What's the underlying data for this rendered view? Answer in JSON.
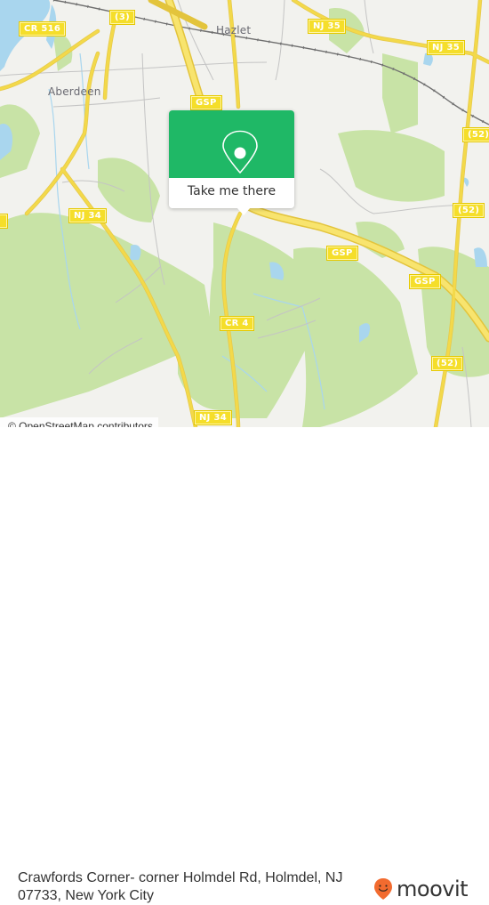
{
  "map": {
    "colors": {
      "background": "#f2f2ee",
      "park": "#c8e3a6",
      "water": "#a9d6ee",
      "highway": "#f3d94a",
      "minor_road": "#bdbdbd",
      "rail": "#6f6f6f",
      "shield": "#f5de2a"
    },
    "towns": [
      {
        "id": "hazlet",
        "label": "Hazlet"
      },
      {
        "id": "aberdeen",
        "label": "Aberdeen"
      }
    ],
    "shields": [
      {
        "id": "cr516",
        "label": "CR 516"
      },
      {
        "id": "route3",
        "label": "(3)"
      },
      {
        "id": "nj35-a",
        "label": "NJ 35"
      },
      {
        "id": "nj35-b",
        "label": "NJ 35"
      },
      {
        "id": "gsp-north",
        "label": "GSP"
      },
      {
        "id": "route52-a",
        "label": "(52)"
      },
      {
        "id": "route52-b",
        "label": "(52)"
      },
      {
        "id": "nj34-north",
        "label": "NJ 34"
      },
      {
        "id": "gsp-mid",
        "label": "GSP"
      },
      {
        "id": "gsp-east",
        "label": "GSP"
      },
      {
        "id": "cr4",
        "label": "CR 4"
      },
      {
        "id": "route52-c",
        "label": "(52)"
      },
      {
        "id": "nj34-south",
        "label": "NJ 34"
      }
    ],
    "attribution": "© OpenStreetMap contributors"
  },
  "popup": {
    "icon": "location-pin-icon",
    "button_label": "Take me there",
    "color": "#1fb866"
  },
  "footer": {
    "address": "Crawfords Corner- corner Holmdel Rd, Holmdel, NJ 07733, New York City",
    "logo_text": "moovit",
    "logo_icon": "moovit-smiley-pin-icon",
    "logo_color": "#f26b2f"
  }
}
